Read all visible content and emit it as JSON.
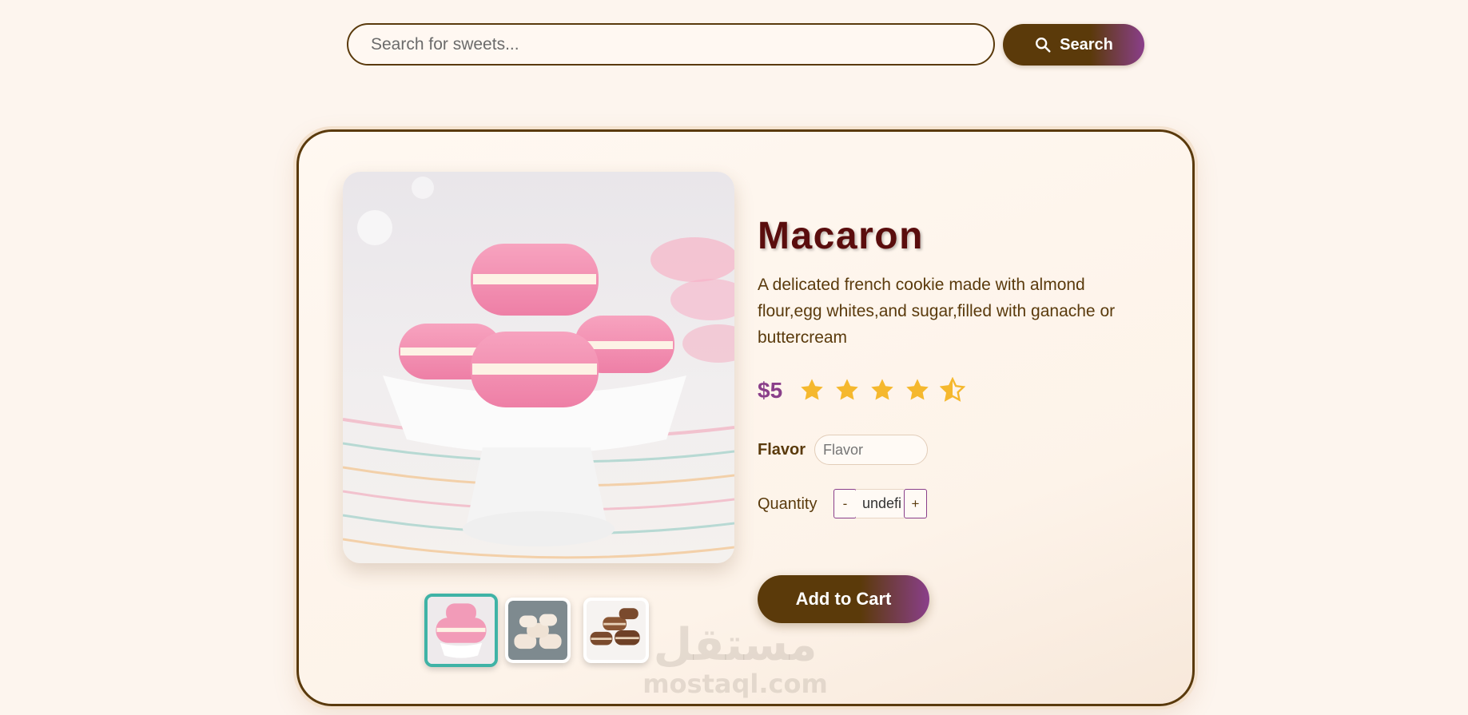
{
  "search": {
    "placeholder": "Search for sweets...",
    "value": "",
    "button_label": "Search",
    "button_icon": "search-icon"
  },
  "product": {
    "title": "Macaron",
    "description": "A delicated french cookie made with almond flour,egg whites,and sugar,filled with ganache or buttercream",
    "price": "$5",
    "rating": 4.5,
    "rating_max": 5,
    "flavor_label": "Flavor",
    "flavor_placeholder": "Flavor",
    "quantity_label": "Quantity",
    "quantity_value": "undefined",
    "decrement_label": "-",
    "increment_label": "+",
    "add_to_cart_label": "Add to Cart"
  },
  "gallery": {
    "thumbnails": [
      {
        "name": "pink-macarons",
        "active": true
      },
      {
        "name": "white-macarons",
        "active": false
      },
      {
        "name": "chocolate-macarons",
        "active": false
      }
    ]
  },
  "watermark": {
    "arabic": "مستقل",
    "latin": "mostaql.com"
  },
  "colors": {
    "background": "#fdf5ee",
    "brand_brown": "#5b3a0a",
    "accent_purple": "#8a3f8a",
    "title": "#5a0d0d",
    "star": "#f5b82e",
    "active_thumb": "#3fb3a6"
  }
}
